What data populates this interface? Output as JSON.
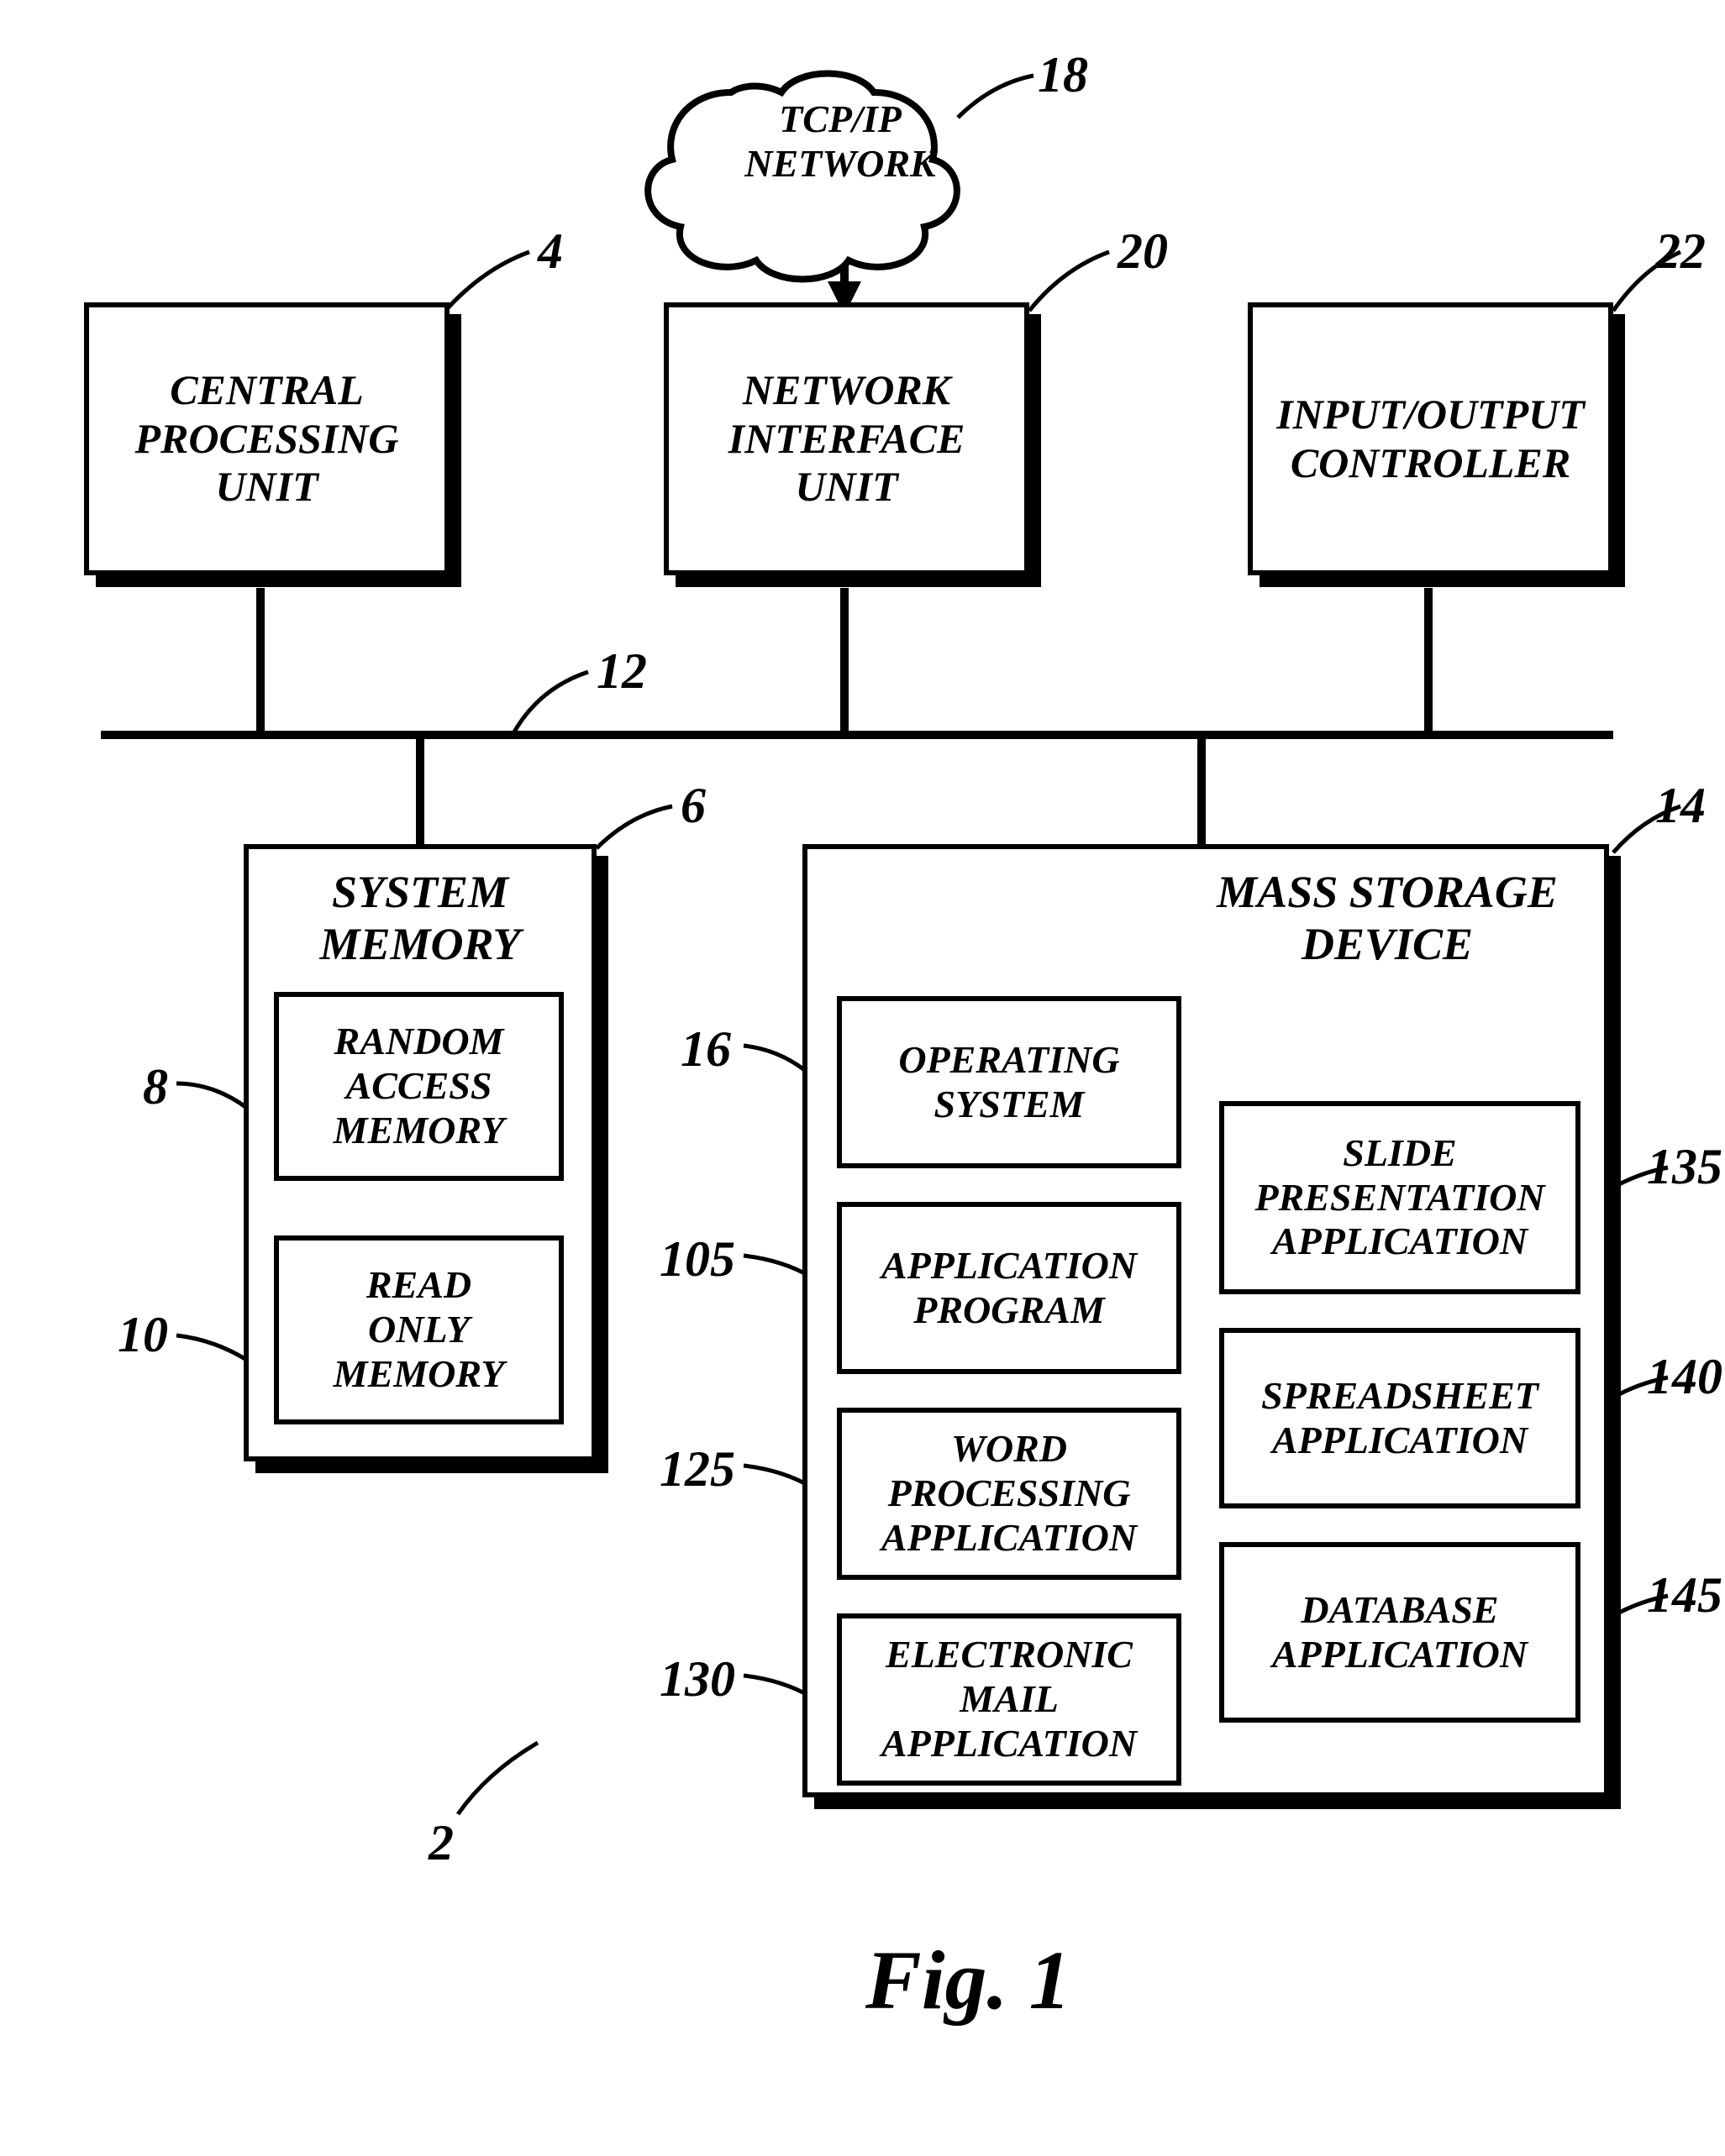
{
  "figure_label": "Fig. 1",
  "system_ref": "2",
  "bus_ref": "12",
  "cloud": {
    "label": "TCP/IP\nNETWORK",
    "ref": "18"
  },
  "top": {
    "cpu": {
      "label": "CENTRAL\nPROCESSING\nUNIT",
      "ref": "4"
    },
    "nic": {
      "label": "NETWORK\nINTERFACE\nUNIT",
      "ref": "20"
    },
    "io": {
      "label": "INPUT/OUTPUT\nCONTROLLER",
      "ref": "22"
    }
  },
  "sysmem": {
    "title": "SYSTEM\nMEMORY",
    "ref": "6",
    "ram": {
      "label": "RANDOM\nACCESS\nMEMORY",
      "ref": "8"
    },
    "rom": {
      "label": "READ\nONLY\nMEMORY",
      "ref": "10"
    }
  },
  "storage": {
    "title": "MASS STORAGE\nDEVICE",
    "ref": "14",
    "left": [
      {
        "label": "OPERATING\nSYSTEM",
        "ref": "16"
      },
      {
        "label": "APPLICATION\nPROGRAM",
        "ref": "105"
      },
      {
        "label": "WORD\nPROCESSING\nAPPLICATION",
        "ref": "125"
      },
      {
        "label": "ELECTRONIC\nMAIL\nAPPLICATION",
        "ref": "130"
      }
    ],
    "right": [
      {
        "label": "SLIDE\nPRESENTATION\nAPPLICATION",
        "ref": "135"
      },
      {
        "label": "SPREADSHEET\nAPPLICATION",
        "ref": "140"
      },
      {
        "label": "DATABASE\nAPPLICATION",
        "ref": "145"
      }
    ]
  }
}
